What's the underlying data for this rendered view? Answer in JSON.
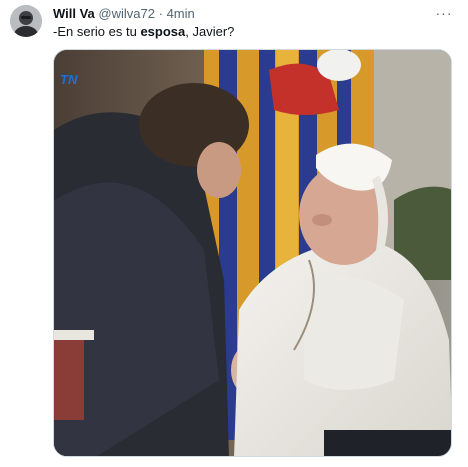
{
  "tweet": {
    "author_name": "Will Va",
    "handle": "@wilva72",
    "separator": "·",
    "time": "4min",
    "more_label": "···",
    "text_before": "-En serio es tu ",
    "text_bold": "esposa",
    "text_after": ", Javier?"
  },
  "media": {
    "watermark_text": "TN"
  },
  "colors": {
    "text_primary": "#0f1419",
    "text_secondary": "#536471",
    "border": "#cfd9de",
    "watermark_blue": "#1d6fe0",
    "watermark_red": "#e63b2e"
  }
}
